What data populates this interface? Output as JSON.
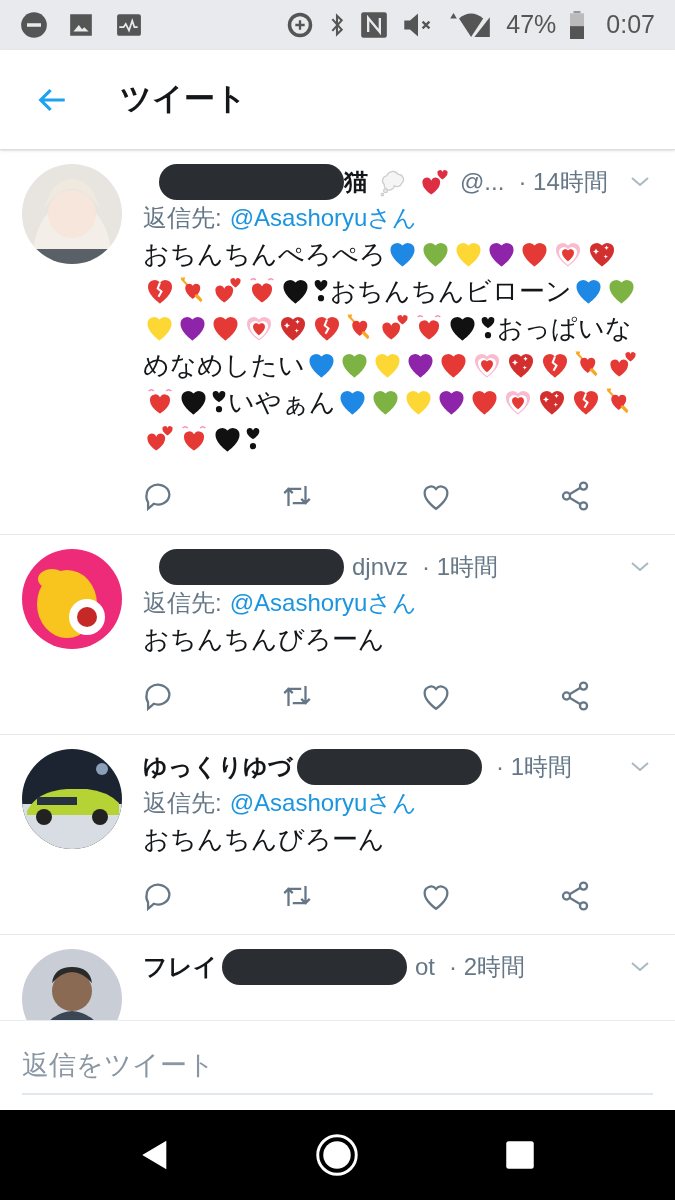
{
  "status_bar": {
    "battery_text": "47%",
    "time": "0:07"
  },
  "header": {
    "title": "ツイート"
  },
  "tweets": [
    {
      "avatar": {
        "kind": "figure"
      },
      "redacted": true,
      "name_after": "猫",
      "name_emoji": [
        {
          "kind": "thought"
        },
        {
          "kind": "two",
          "color": "#dd2e44"
        }
      ],
      "handle": "@...",
      "time": "· 14時間",
      "reply_label": "返信先:",
      "reply_to": "@Asashoryuさん",
      "actions": true,
      "body": [
        {
          "kind": "text",
          "text": "おちんちんぺろぺろ"
        },
        {
          "kind": "heart",
          "color": "#1e88e5"
        },
        {
          "kind": "heart",
          "color": "#7cb342"
        },
        {
          "kind": "heart",
          "color": "#fdd835"
        },
        {
          "kind": "heart",
          "color": "#8e24aa"
        },
        {
          "kind": "heart",
          "color": "#e53935"
        },
        {
          "kind": "growing",
          "color": "#e53935"
        },
        {
          "kind": "sparkling",
          "color": "#d32f2f"
        },
        {
          "kind": "broken",
          "color": "#e53935"
        },
        {
          "kind": "arrow",
          "color": "#e53935"
        },
        {
          "kind": "two",
          "color": "#e53935"
        },
        {
          "kind": "beating",
          "color": "#e53935"
        },
        {
          "kind": "heart",
          "color": "#111111"
        },
        {
          "kind": "exclamation",
          "color": "#111111"
        },
        {
          "kind": "text",
          "text": "おちんちんビローン"
        },
        {
          "kind": "heart",
          "color": "#1e88e5"
        },
        {
          "kind": "heart",
          "color": "#7cb342"
        },
        {
          "kind": "heart",
          "color": "#fdd835"
        },
        {
          "kind": "heart",
          "color": "#8e24aa"
        },
        {
          "kind": "heart",
          "color": "#e53935"
        },
        {
          "kind": "growing",
          "color": "#e53935"
        },
        {
          "kind": "sparkling",
          "color": "#d32f2f"
        },
        {
          "kind": "broken",
          "color": "#e53935"
        },
        {
          "kind": "arrow",
          "color": "#e53935"
        },
        {
          "kind": "two",
          "color": "#e53935"
        },
        {
          "kind": "beating",
          "color": "#e53935"
        },
        {
          "kind": "heart",
          "color": "#111111"
        },
        {
          "kind": "exclamation",
          "color": "#111111"
        },
        {
          "kind": "text",
          "text": "おっぱいなめなめしたい"
        },
        {
          "kind": "heart",
          "color": "#1e88e5"
        },
        {
          "kind": "heart",
          "color": "#7cb342"
        },
        {
          "kind": "heart",
          "color": "#fdd835"
        },
        {
          "kind": "heart",
          "color": "#8e24aa"
        },
        {
          "kind": "heart",
          "color": "#e53935"
        },
        {
          "kind": "growing",
          "color": "#e53935"
        },
        {
          "kind": "sparkling",
          "color": "#d32f2f"
        },
        {
          "kind": "broken",
          "color": "#e53935"
        },
        {
          "kind": "arrow",
          "color": "#e53935"
        },
        {
          "kind": "two",
          "color": "#e53935"
        },
        {
          "kind": "beating",
          "color": "#e53935"
        },
        {
          "kind": "heart",
          "color": "#111111"
        },
        {
          "kind": "exclamation",
          "color": "#111111"
        },
        {
          "kind": "text",
          "text": "いやぁん"
        },
        {
          "kind": "heart",
          "color": "#1e88e5"
        },
        {
          "kind": "heart",
          "color": "#7cb342"
        },
        {
          "kind": "heart",
          "color": "#fdd835"
        },
        {
          "kind": "heart",
          "color": "#8e24aa"
        },
        {
          "kind": "heart",
          "color": "#e53935"
        },
        {
          "kind": "growing",
          "color": "#e53935"
        },
        {
          "kind": "sparkling",
          "color": "#d32f2f"
        },
        {
          "kind": "broken",
          "color": "#e53935"
        },
        {
          "kind": "arrow",
          "color": "#e53935"
        },
        {
          "kind": "two",
          "color": "#e53935"
        },
        {
          "kind": "beating",
          "color": "#e53935"
        },
        {
          "kind": "heart",
          "color": "#111111"
        },
        {
          "kind": "exclamation",
          "color": "#111111"
        }
      ]
    },
    {
      "avatar": {
        "kind": "mascot"
      },
      "redacted": true,
      "handle": "djnvz",
      "time": "· 1時間",
      "reply_label": "返信先:",
      "reply_to": "@Asashoryuさん",
      "actions": true,
      "body": [
        {
          "kind": "text",
          "text": "おちんちんびろーん"
        }
      ]
    },
    {
      "avatar": {
        "kind": "car"
      },
      "name_before": "ゆっくりゆづ",
      "redacted": true,
      "time": "· 1時間",
      "reply_label": "返信先:",
      "reply_to": "@Asashoryuさん",
      "actions": true,
      "body": [
        {
          "kind": "text",
          "text": "おちんちんびろーん"
        }
      ]
    },
    {
      "avatar": {
        "kind": "person"
      },
      "name_before": "フレイ",
      "redacted": true,
      "handle": "ot",
      "time": "· 2時間"
    }
  ],
  "reply_bar": {
    "placeholder": "返信をツイート"
  }
}
